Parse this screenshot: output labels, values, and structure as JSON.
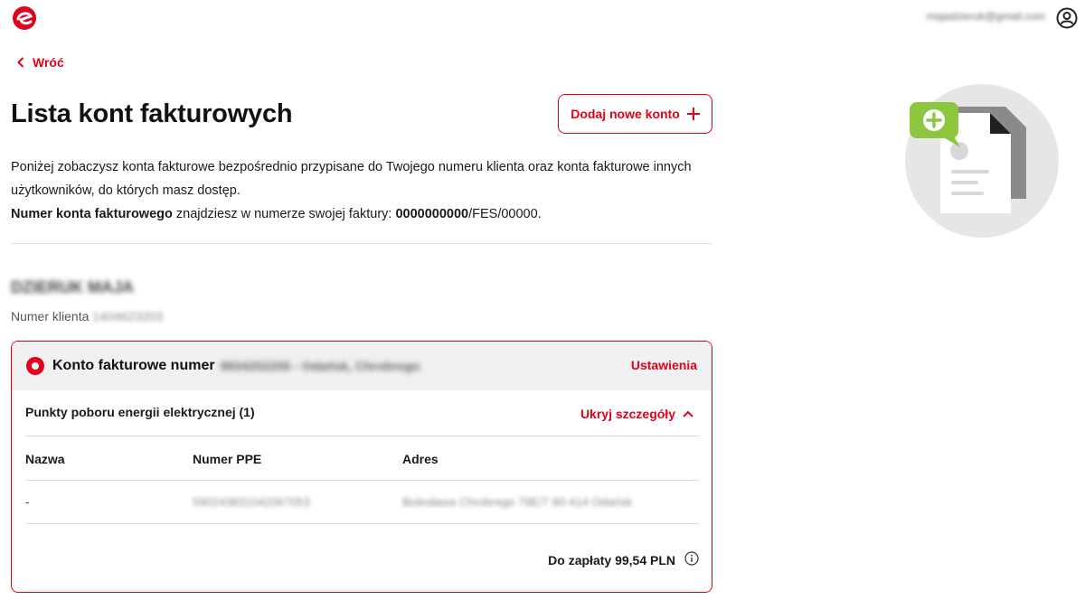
{
  "header": {
    "logo_icon": "brand-logo-icon",
    "user_email": "majadzieruk@gmail.com",
    "user_icon": "user-circle-icon"
  },
  "nav": {
    "back_label": "Wróć"
  },
  "page": {
    "title": "Lista kont fakturowych",
    "add_button_label": "Dodaj nowe konto",
    "description_line1": "Poniżej zobaczysz konta fakturowe bezpośrednio przypisane do Twojego numeru klienta oraz konta fakturowe innych użytkowników, do których masz dostęp.",
    "description_bold": "Numer konta fakturowego",
    "description_mid": " znajdziesz w numerze swojej faktury: ",
    "description_example_bold": "0000000000",
    "description_example_rest": "/FES/00000."
  },
  "client": {
    "name": "DZIERUK MAJA",
    "number_label": "Numer klienta",
    "number_value": "1404623203"
  },
  "account": {
    "title_label": "Konto fakturowe numer",
    "title_value": "9934252255 - Odańsk, Chrobrego",
    "settings_label": "Ustawienia",
    "points_title": "Punkty poboru energii elektrycznej (1)",
    "hide_details_label": "Ukryj szczegóły",
    "table": {
      "headers": [
        "Nazwa",
        "Numer PPE",
        "Adres"
      ],
      "rows": [
        [
          "-",
          "590243831042067053",
          "Bolesława Chrobrego 79E/7 80-414 Odańsk"
        ]
      ]
    },
    "total_label": "Do zapłaty 99,54 PLN"
  },
  "colors": {
    "accent": "#e2001a",
    "header_bg": "#eff0f2",
    "illustration_green": "#8dc63f"
  }
}
